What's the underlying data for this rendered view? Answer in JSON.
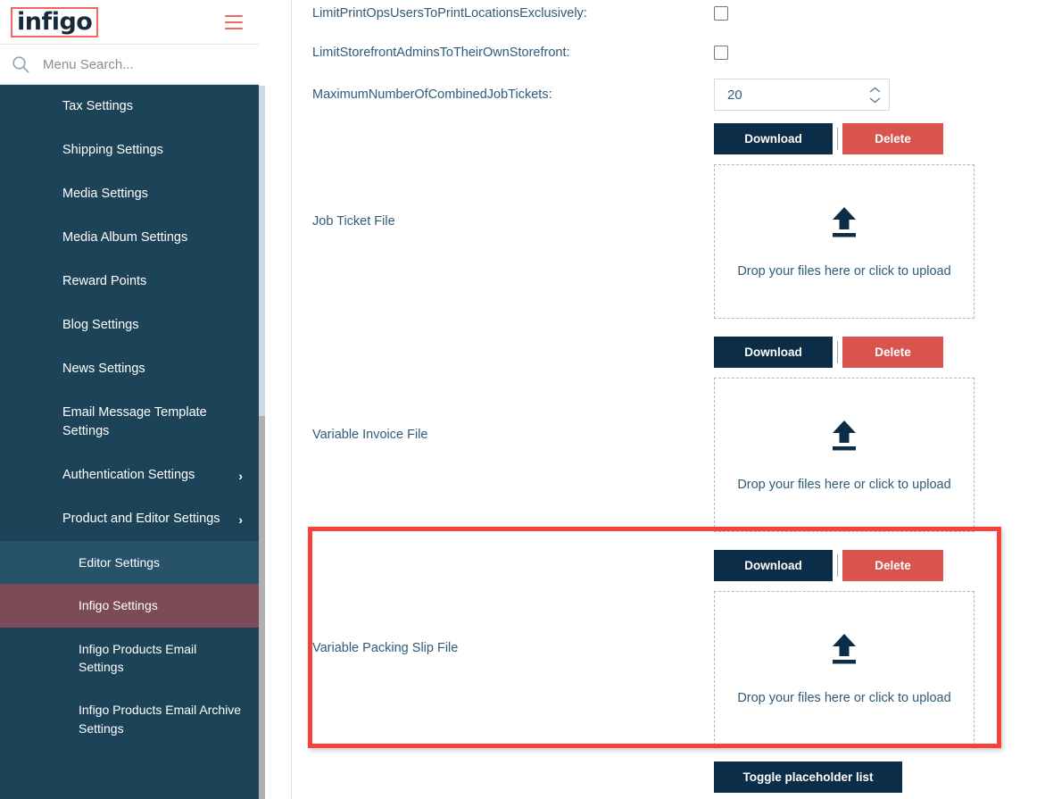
{
  "sidebar": {
    "logo_text": "infigo",
    "menu_icon": "hamburger-icon",
    "search": {
      "placeholder": "Menu Search...",
      "value": "",
      "icon": "search-icon"
    },
    "items": [
      {
        "label": "Tax Settings",
        "level": "top",
        "state": "normal",
        "chevron": ""
      },
      {
        "label": "Shipping Settings",
        "level": "top",
        "state": "normal",
        "chevron": ""
      },
      {
        "label": "Media Settings",
        "level": "top",
        "state": "normal",
        "chevron": ""
      },
      {
        "label": "Media Album Settings",
        "level": "top",
        "state": "normal",
        "chevron": ""
      },
      {
        "label": "Reward Points",
        "level": "top",
        "state": "normal",
        "chevron": ""
      },
      {
        "label": "Blog Settings",
        "level": "top",
        "state": "normal",
        "chevron": ""
      },
      {
        "label": "News Settings",
        "level": "top",
        "state": "normal",
        "chevron": ""
      },
      {
        "label": "Email Message Template Settings",
        "level": "top",
        "state": "normal",
        "chevron": ""
      },
      {
        "label": "Authentication Settings",
        "level": "top",
        "state": "normal",
        "chevron": "›"
      },
      {
        "label": "Product and Editor Settings",
        "level": "top",
        "state": "normal",
        "chevron": "›"
      },
      {
        "label": "Editor Settings",
        "level": "sub",
        "state": "hover",
        "chevron": ""
      },
      {
        "label": "Infigo Settings",
        "level": "sub",
        "state": "active",
        "chevron": ""
      },
      {
        "label": "Infigo Products Email Settings",
        "level": "sub",
        "state": "normal",
        "chevron": ""
      },
      {
        "label": "Infigo Products Email Archive Settings",
        "level": "sub",
        "state": "normal",
        "chevron": ""
      }
    ],
    "colors": {
      "background": "#1d4359",
      "active": "#7d4a57",
      "hover": "#27526a",
      "accent": "#f4645f"
    }
  },
  "main": {
    "checkbox_rows": [
      {
        "label": "LimitPrintOpsUsersToPrintLocationsExclusively:",
        "checked": false
      },
      {
        "label": "LimitStorefrontAdminsToTheirOwnStorefront:",
        "checked": false
      }
    ],
    "number_row": {
      "label": "MaximumNumberOfCombinedJobTickets:",
      "value": "20"
    },
    "file_fields": [
      {
        "label": "Job Ticket File",
        "download_label": "Download",
        "delete_label": "Delete",
        "dropzone_text": "Drop your files here or click to upload",
        "upload_icon": "upload-arrow-icon"
      },
      {
        "label": "Variable Invoice File",
        "download_label": "Download",
        "delete_label": "Delete",
        "dropzone_text": "Drop your files here or click to upload",
        "upload_icon": "upload-arrow-icon"
      },
      {
        "label": "Variable Packing Slip File",
        "download_label": "Download",
        "delete_label": "Delete",
        "dropzone_text": "Drop your files here or click to upload",
        "upload_icon": "upload-arrow-icon"
      }
    ],
    "toggle_placeholder_label": "Toggle placeholder list",
    "highlight_color": "#f4433a",
    "button_colors": {
      "download": "#0c2d47",
      "delete": "#d9534f"
    }
  }
}
